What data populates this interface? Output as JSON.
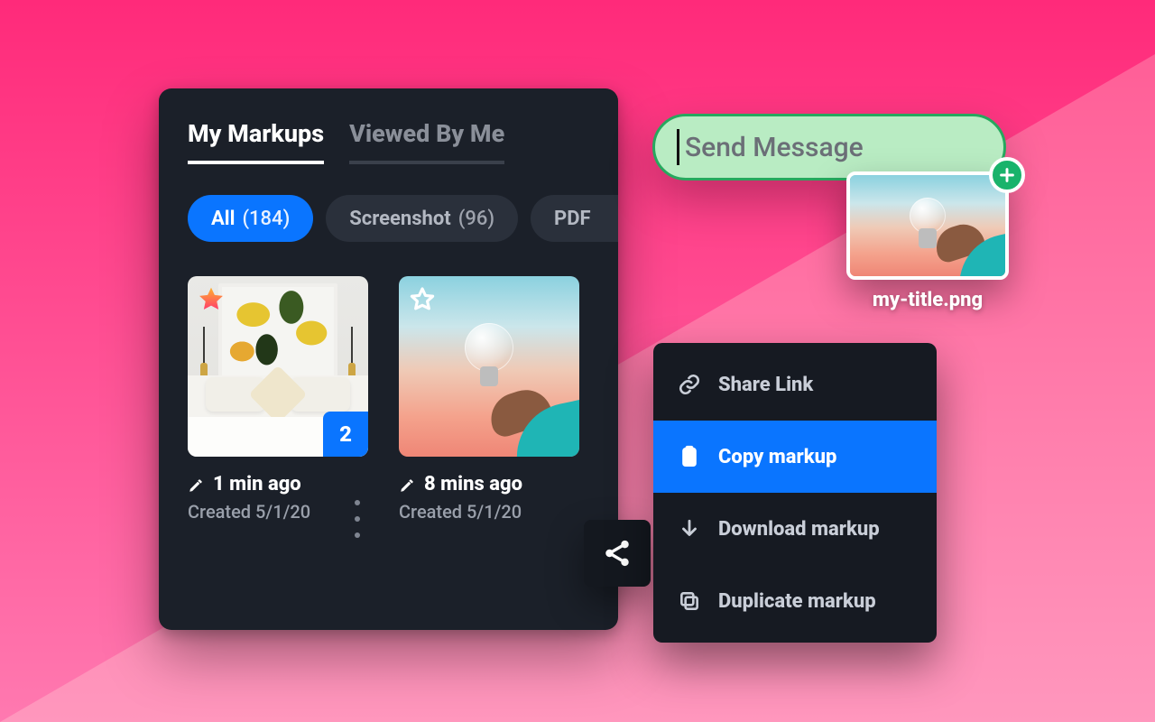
{
  "tabs": {
    "my_markups": "My Markups",
    "viewed_by_me": "Viewed By Me"
  },
  "filters": {
    "all": {
      "label": "All",
      "count": "(184)"
    },
    "screenshot": {
      "label": "Screenshot",
      "count": "(96)"
    },
    "pdf": {
      "label": "PDF"
    }
  },
  "cards": {
    "c0": {
      "badge": "2",
      "edited": "1 min ago",
      "created": "Created 5/1/20"
    },
    "c1": {
      "edited": "8 mins ago",
      "created": "Created 5/1/20"
    }
  },
  "menu": {
    "share_link": "Share Link",
    "copy_markup": "Copy markup",
    "download_markup": "Download markup",
    "duplicate_markup": "Duplicate markup"
  },
  "message": {
    "placeholder": "Send Message"
  },
  "attachment": {
    "filename": "my-title.png"
  }
}
